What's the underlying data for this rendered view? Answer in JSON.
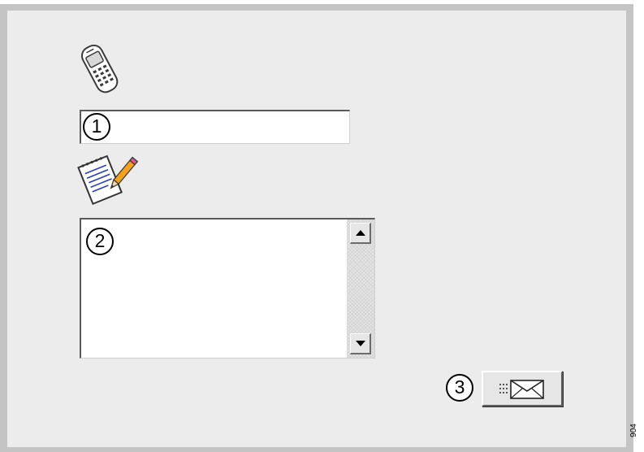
{
  "callouts": {
    "phone_number": "1",
    "message": "2",
    "send": "3"
  },
  "phone_input": {
    "value": "",
    "placeholder": ""
  },
  "message_box": {
    "value": "",
    "placeholder": ""
  },
  "icons": {
    "phone": "mobile-phone-icon",
    "message": "notepad-pencil-icon",
    "send": "envelope-icon"
  },
  "figure_id": "904",
  "colors": {
    "panel_background": "#ececec",
    "frame_border": "#c4c4c4",
    "callout_border": "#000000"
  }
}
